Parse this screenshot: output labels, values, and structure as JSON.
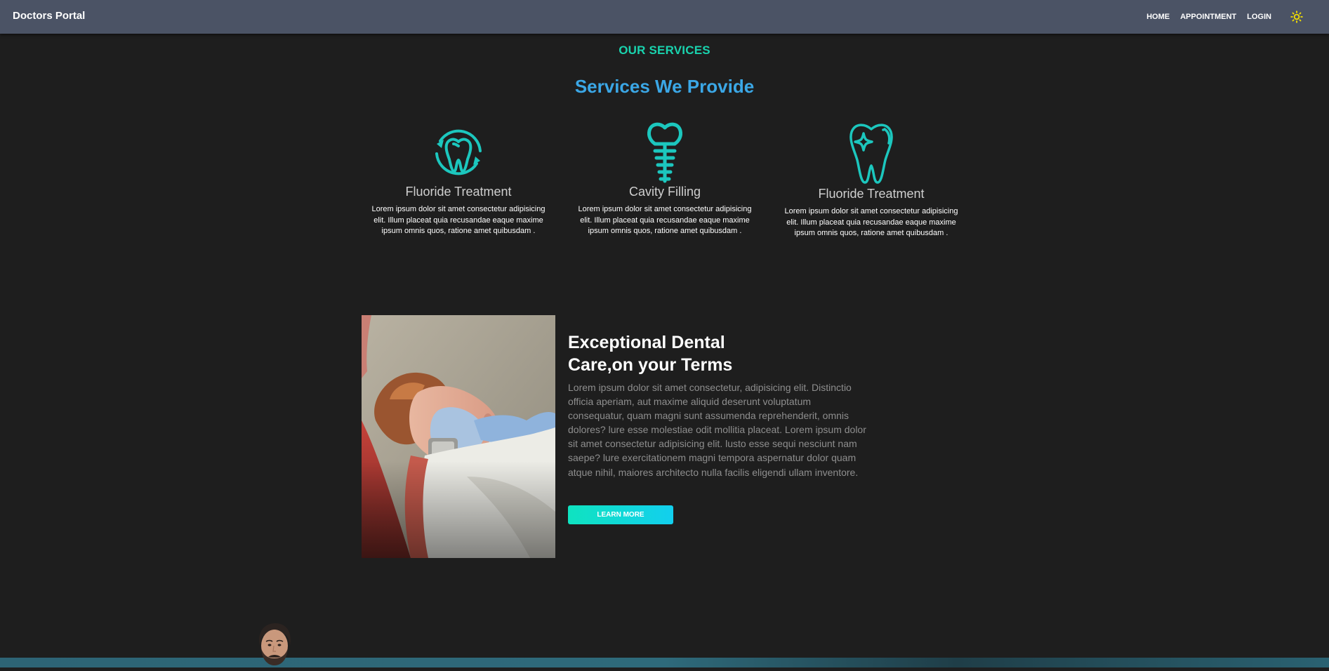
{
  "navbar": {
    "brand": "Doctors Portal",
    "links": [
      "HOME",
      "APPOINTMENT",
      "LOGIN"
    ],
    "theme_icon": "sun-icon"
  },
  "services": {
    "eyebrow": "OUR SERVICES",
    "title": "Services We Provide",
    "items": [
      {
        "icon": "tooth-cycle-icon",
        "name": "Fluoride Treatment",
        "description": "Lorem ipsum dolor sit amet consectetur adipisicing elit. Illum placeat quia recusandae eaque maxime ipsum omnis quos, ratione amet quibusdam ."
      },
      {
        "icon": "dental-implant-icon",
        "name": "Cavity Filling",
        "description": "Lorem ipsum dolor sit amet consectetur adipisicing elit. Illum placeat quia recusandae eaque maxime ipsum omnis quos, ratione amet quibusdam ."
      },
      {
        "icon": "sparkling-tooth-icon",
        "name": "Fluoride Treatment",
        "description": "Lorem ipsum dolor sit amet consectetur adipisicing elit. Illum placeat quia recusandae eaque maxime ipsum omnis quos, ratione amet quibusdam ."
      }
    ]
  },
  "care": {
    "title_line1": "Exceptional Dental",
    "title_line2": "Care,on your Terms",
    "text": "Lorem ipsum dolor sit amet consectetur, adipisicing elit. Distinctio officia aperiam, aut maxime aliquid deserunt voluptatum consequatur, quam magni sunt assumenda reprehenderit, omnis dolores? lure esse molestiae odit mollitia placeat. Lorem ipsum dolor sit amet consectetur adipisicing elit. lusto esse sequi nesciunt nam saepe? lure exercitationem magni tempora aspernatur dolor quam atque nihil, maiores architecto nulla facilis eligendi ullam inventore.",
    "button_label": "LEARN MORE"
  },
  "colors": {
    "accent_teal": "#19d3ae",
    "title_blue": "#3ba7e6",
    "navbar": "#4b5365",
    "background": "#1e1e1e",
    "theme_icon": "#f5e000"
  }
}
